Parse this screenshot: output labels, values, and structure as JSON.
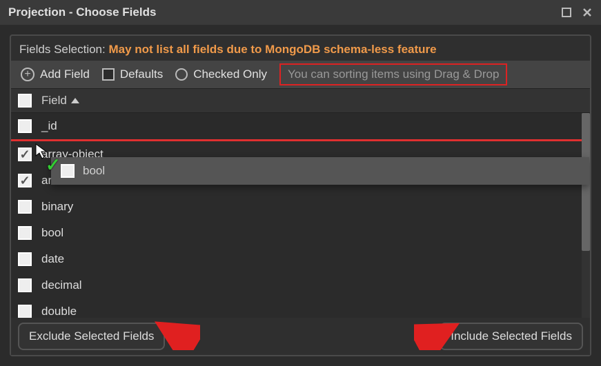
{
  "titlebar": {
    "title": "Projection - Choose Fields"
  },
  "header": {
    "label": "Fields Selection:",
    "warning": "May not list all fields due to MongoDB schema-less feature"
  },
  "toolbar": {
    "add_field": "Add Field",
    "defaults": "Defaults",
    "checked_only": "Checked Only",
    "drag_hint": "You can sorting items using Drag & Drop"
  },
  "table": {
    "header_label": "Field",
    "drag_ghost_label": "bool",
    "rows": [
      {
        "name": "_id",
        "checked": false
      },
      {
        "name": "array-object",
        "checked": true
      },
      {
        "name": "ar...",
        "checked": true
      },
      {
        "name": "binary",
        "checked": false
      },
      {
        "name": "bool",
        "checked": false
      },
      {
        "name": "date",
        "checked": false
      },
      {
        "name": "decimal",
        "checked": false
      },
      {
        "name": "double",
        "checked": false
      }
    ]
  },
  "footer": {
    "exclude": "Exclude Selected Fields",
    "include": "Include Selected Fields"
  },
  "colors": {
    "accent_red": "#d22",
    "warn_orange": "#f09a4a"
  }
}
